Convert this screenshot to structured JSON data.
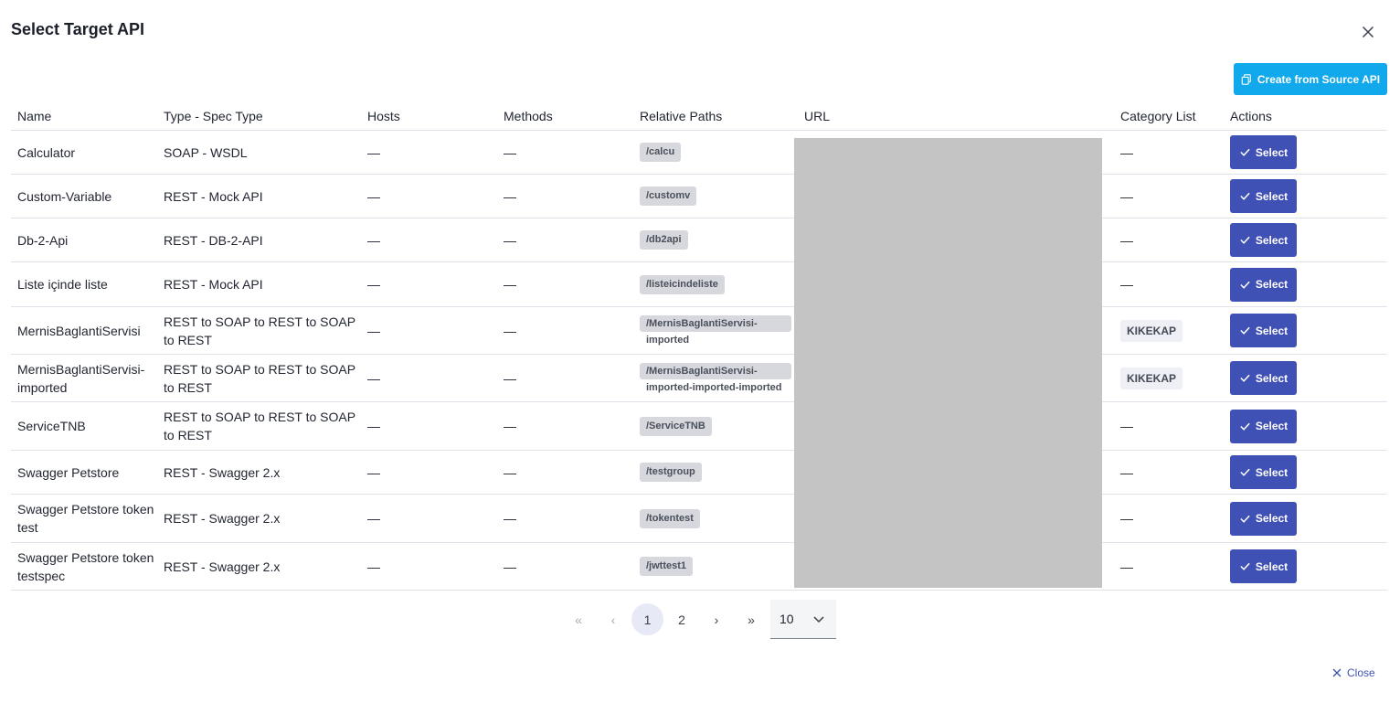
{
  "dialog": {
    "title": "Select Target API",
    "create_button": "Create from Source API",
    "close_label": "Close"
  },
  "table": {
    "headers": {
      "name": "Name",
      "type": "Type - Spec Type",
      "hosts": "Hosts",
      "methods": "Methods",
      "paths": "Relative Paths",
      "url": "URL",
      "category": "Category List",
      "actions": "Actions"
    },
    "rows": [
      {
        "name": "Calculator",
        "type": "SOAP - WSDL",
        "hosts": "—",
        "methods": "—",
        "path": "/calcu",
        "path2": "",
        "category": "—",
        "action": "Select"
      },
      {
        "name": "Custom-Variable",
        "type": "REST - Mock API",
        "hosts": "—",
        "methods": "—",
        "path": "/customv",
        "path2": "",
        "category": "—",
        "action": "Select"
      },
      {
        "name": "Db-2-Api",
        "type": "REST - DB-2-API",
        "hosts": "—",
        "methods": "—",
        "path": "/db2api",
        "path2": "",
        "category": "—",
        "action": "Select"
      },
      {
        "name": "Liste içinde liste",
        "type": "REST - Mock API",
        "hosts": "—",
        "methods": "—",
        "path": "/listeicindeliste",
        "path2": "",
        "category": "—",
        "action": "Select"
      },
      {
        "name": "MernisBaglantiServisi",
        "type": "REST to SOAP to REST to SOAP to REST",
        "hosts": "—",
        "methods": "—",
        "path": "/MernisBaglantiServisi-",
        "path2": "imported",
        "category": "KIKEKAP",
        "action": "Select"
      },
      {
        "name": "MernisBaglantiServisi-imported",
        "type": "REST to SOAP to REST to SOAP to REST",
        "hosts": "—",
        "methods": "—",
        "path": "/MernisBaglantiServisi-",
        "path2": "imported-imported-imported",
        "category": "KIKEKAP",
        "action": "Select"
      },
      {
        "name": "ServiceTNB",
        "type": "REST to SOAP to REST to SOAP to REST",
        "hosts": "—",
        "methods": "—",
        "path": "/ServiceTNB",
        "path2": "",
        "category": "—",
        "action": "Select"
      },
      {
        "name": "Swagger Petstore",
        "type": "REST - Swagger 2.x",
        "hosts": "—",
        "methods": "—",
        "path": "/testgroup",
        "path2": "",
        "category": "—",
        "action": "Select"
      },
      {
        "name": "Swagger Petstore token test",
        "type": "REST - Swagger 2.x",
        "hosts": "—",
        "methods": "—",
        "path": "/tokentest",
        "path2": "",
        "category": "—",
        "action": "Select"
      },
      {
        "name": "Swagger Petstore token testspec",
        "type": "REST - Swagger 2.x",
        "hosts": "—",
        "methods": "—",
        "path": "/jwttest1",
        "path2": "",
        "category": "—",
        "action": "Select"
      }
    ]
  },
  "pagination": {
    "first": "«",
    "prev": "‹",
    "pages": [
      "1",
      "2"
    ],
    "current_page": "1",
    "next": "›",
    "last": "»",
    "page_size": "10"
  },
  "icons": {
    "close": "close-icon",
    "copy": "copy-icon",
    "check": "check-icon",
    "chevron": "chevron-down-icon"
  },
  "colors": {
    "primary": "#3f51b5",
    "accent": "#11a8ec"
  }
}
